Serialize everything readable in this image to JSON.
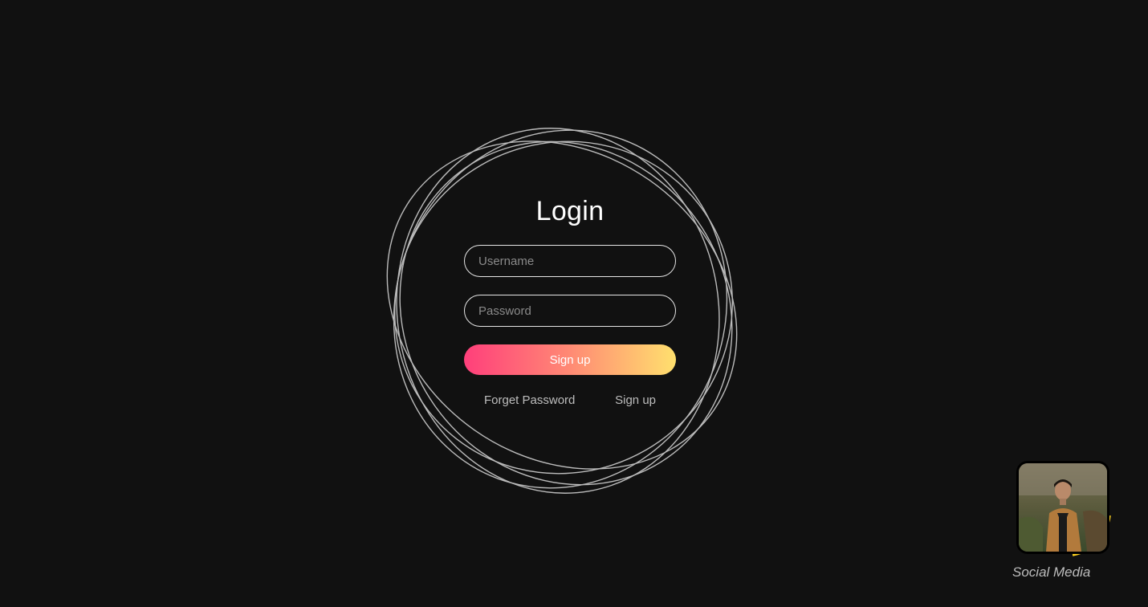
{
  "login": {
    "title": "Login",
    "username_placeholder": "Username",
    "password_placeholder": "Password",
    "submit_label": "Sign up",
    "forgot_link": "Forget Password",
    "signup_link": "Sign up"
  },
  "social": {
    "label": "Social Media"
  },
  "colors": {
    "background": "#111111",
    "gradient_start": "#ff3f7b",
    "gradient_end": "#ffe06e",
    "ring_accent": "#ffd21f"
  }
}
